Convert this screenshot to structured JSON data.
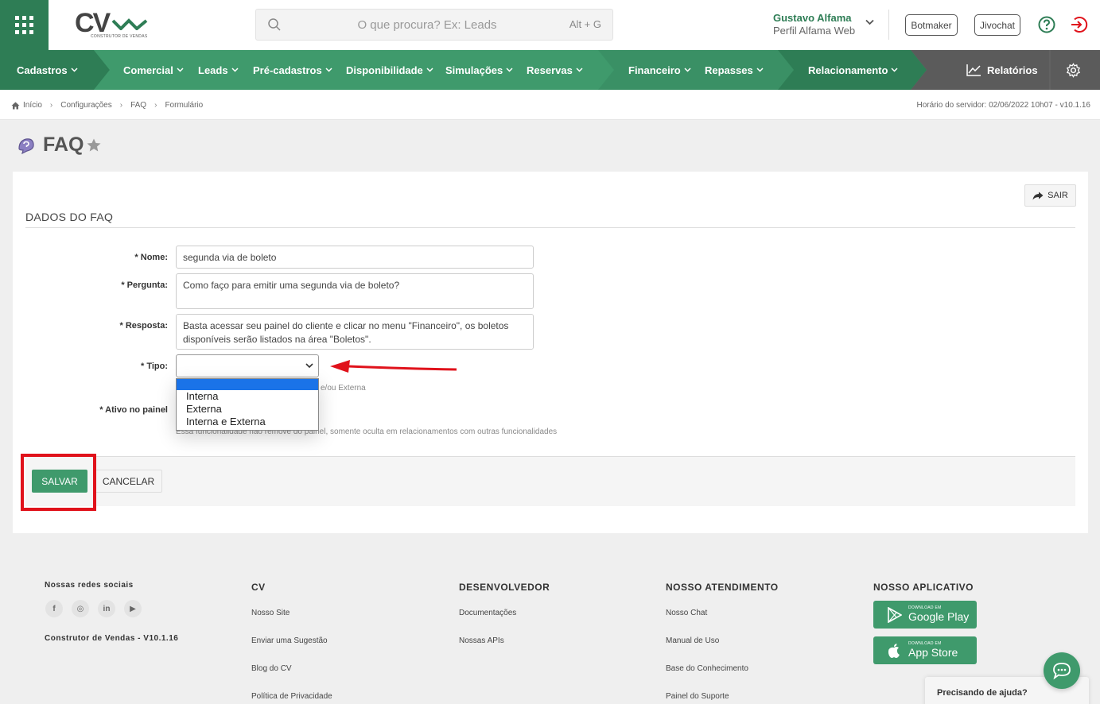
{
  "colors": {
    "brand_green": "#3f9a6c",
    "dark_green": "#2e7d55",
    "annotation_red": "#e0121b",
    "page_bg": "#efefef"
  },
  "header": {
    "logo_text": "CV",
    "logo_sub": "CONSTRUTOR DE VENDAS",
    "search": {
      "placeholder": "O que procura? Ex: Leads",
      "shortcut": "Alt + G"
    },
    "user": {
      "name": "Gustavo Alfama",
      "role": "Perfil Alfama Web"
    },
    "buttons": {
      "botmaker": "Botmaker",
      "jivochat": "Jivochat"
    },
    "icons": [
      "apps-grid-icon",
      "search-icon",
      "chevron-down-icon",
      "help-icon",
      "logout-icon"
    ]
  },
  "nav": {
    "items": [
      "Cadastros",
      "Comercial",
      "Leads",
      "Pré-cadastros",
      "Disponibilidade",
      "Simulações",
      "Reservas",
      "Financeiro",
      "Repasses",
      "Relacionamento"
    ],
    "reports": "Relatórios",
    "icons": [
      "chart-icon",
      "gear-icon"
    ]
  },
  "breadcrumb": {
    "items": [
      "Início",
      "Configurações",
      "FAQ",
      "Formulário"
    ],
    "server_time": "Horário do servidor: 02/06/2022 10h07 - v10.1.16"
  },
  "page": {
    "title": "FAQ"
  },
  "form": {
    "exit_label": "SAIR",
    "section_title": "DADOS DO FAQ",
    "fields": {
      "nome": {
        "label": "Nome:",
        "value": "segunda via de boleto"
      },
      "pergunta": {
        "label": "Pergunta:",
        "value": "Como faço para emitir uma segunda via de boleto?"
      },
      "resposta": {
        "label": "Resposta:",
        "value": "Basta acessar seu painel do cliente e clicar no menu \"Financeiro\", os boletos disponíveis serão listados na área \"Boletos\"."
      },
      "tipo": {
        "label": "Tipo:",
        "hint": "e/ou Externa",
        "selected": "",
        "options": [
          "Interna",
          "Externa",
          "Interna e Externa"
        ]
      },
      "ativo": {
        "label": "Ativo no painel",
        "hint": "Essa funcionalidade não remove do painel, somente oculta em relacionamentos com outras funcionalidades"
      }
    },
    "required_mark": "*",
    "save_label": "SALVAR",
    "cancel_label": "CANCELAR"
  },
  "footer": {
    "social": {
      "title": "Nossas redes sociais",
      "networks": [
        "f",
        "◎",
        "in",
        "▶"
      ],
      "version": "Construtor de Vendas - V10.1.16"
    },
    "cv": {
      "title": "CV",
      "links": [
        "Nosso Site",
        "Enviar uma Sugestão",
        "Blog do CV",
        "Política de Privacidade"
      ]
    },
    "dev": {
      "title": "DESENVOLVEDOR",
      "links": [
        "Documentações",
        "Nossas APIs"
      ]
    },
    "support": {
      "title": "NOSSO ATENDIMENTO",
      "links": [
        "Nosso Chat",
        "Manual de Uso",
        "Base do Conhecimento",
        "Painel do Suporte"
      ]
    },
    "app": {
      "title": "NOSSO APLICATIVO",
      "google_small": "DOWNLOAD EM",
      "google_big": "Google Play",
      "apple_small": "DOWNLOAD EM",
      "apple_big": "App Store"
    }
  },
  "help_widget": {
    "label": "Precisando de ajuda?"
  }
}
